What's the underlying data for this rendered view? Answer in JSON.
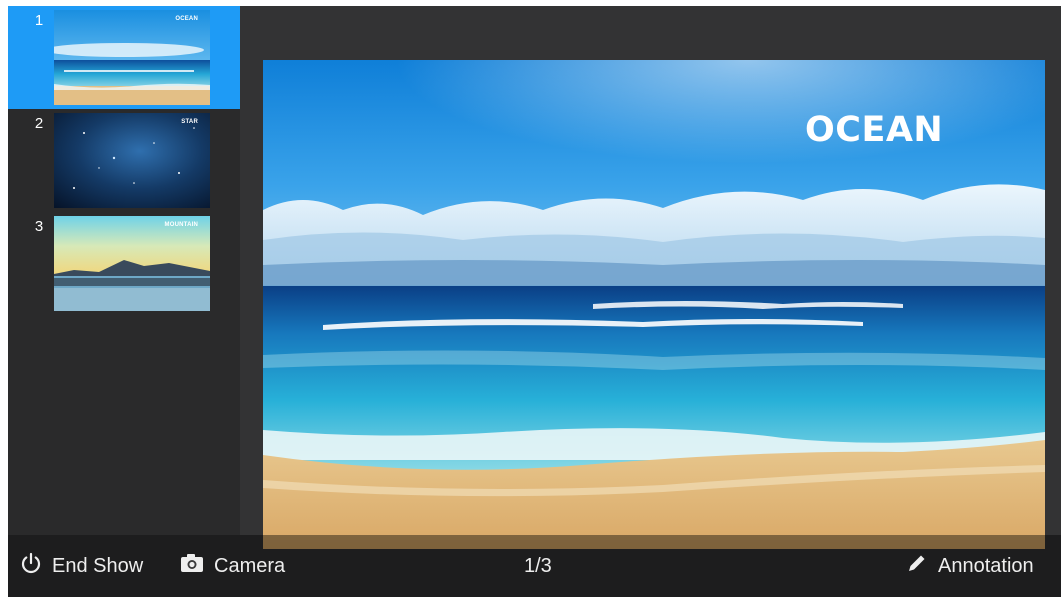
{
  "sidebar": {
    "slides": [
      {
        "number": "1",
        "title": "OCEAN",
        "selected": true
      },
      {
        "number": "2",
        "title": "STAR",
        "selected": false
      },
      {
        "number": "3",
        "title": "MOUNTAIN",
        "selected": false
      }
    ]
  },
  "stage": {
    "title": "OCEAN"
  },
  "toolbar": {
    "end_show_label": "End Show",
    "camera_label": "Camera",
    "page_indicator": "1/3",
    "annotation_label": "Annotation"
  },
  "colors": {
    "accent": "#1e9bf6",
    "panel": "#2a2a2b",
    "background": "#333334"
  }
}
